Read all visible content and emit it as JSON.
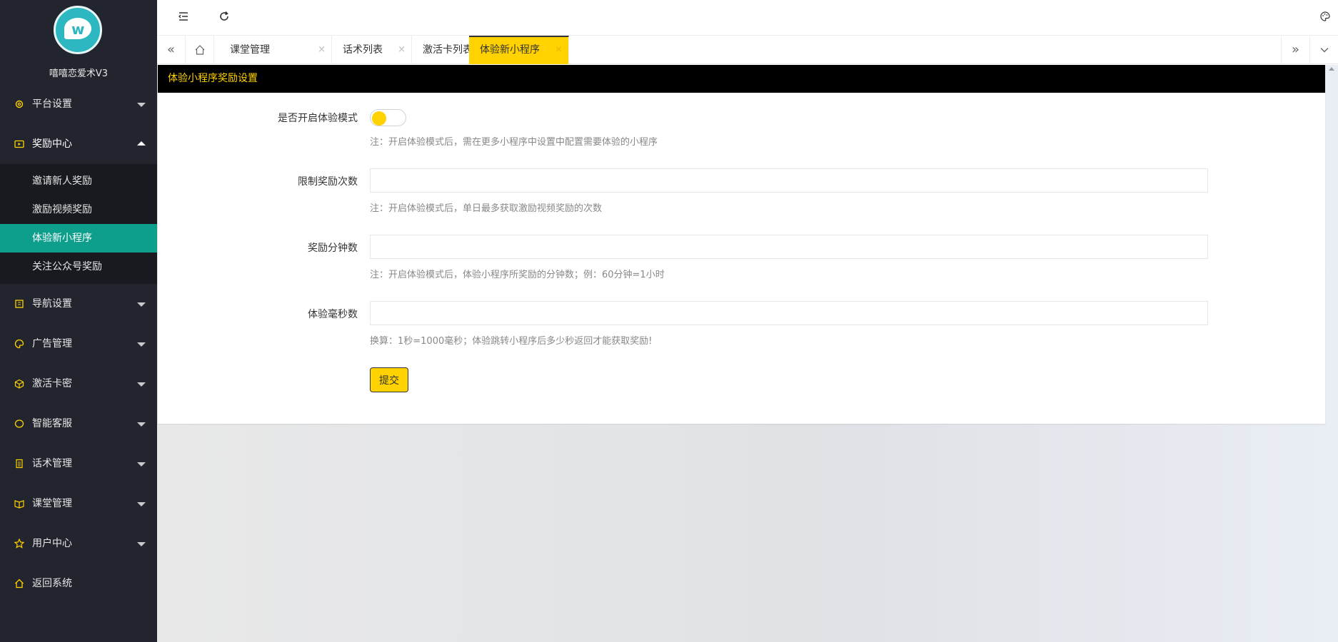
{
  "sidebar": {
    "app_name": "嘻嘻恋爱术V3",
    "menu": [
      {
        "label": "平台设置",
        "icon": "gear-icon"
      },
      {
        "label": "奖励中心",
        "icon": "video-icon"
      },
      {
        "label": "导航设置",
        "icon": "book-icon"
      },
      {
        "label": "广告管理",
        "icon": "palette-icon"
      },
      {
        "label": "激活卡密",
        "icon": "cube-icon"
      },
      {
        "label": "智能客服",
        "icon": "chat-icon"
      },
      {
        "label": "话术管理",
        "icon": "doc-icon"
      },
      {
        "label": "课堂管理",
        "icon": "reading-icon"
      },
      {
        "label": "用户中心",
        "icon": "star-icon"
      },
      {
        "label": "返回系统",
        "icon": "home-icon"
      }
    ],
    "reward_submenu": [
      {
        "label": "邀请新人奖励"
      },
      {
        "label": "激励视频奖励"
      },
      {
        "label": "体验新小程序"
      },
      {
        "label": "关注公众号奖励"
      }
    ]
  },
  "tabs": [
    {
      "label": "课堂管理"
    },
    {
      "label": "话术列表"
    },
    {
      "label": "激活卡列表"
    },
    {
      "label": "体验新小程序"
    }
  ],
  "tab_close_glyph": "×",
  "card": {
    "title": "体验小程序奖励设置",
    "fields": {
      "enable": {
        "label": "是否开启体验模式",
        "tip": "注：开启体验模式后，需在更多小程序中设置中配置需要体验的小程序"
      },
      "limit": {
        "label": "限制奖励次数",
        "value": "",
        "tip": "注：开启体验模式后，单日最多获取激励视频奖励的次数"
      },
      "minutes": {
        "label": "奖励分钟数",
        "value": "",
        "tip": "注：开启体验模式后，体验小程序所奖励的分钟数；例：60分钟=1小时"
      },
      "ms": {
        "label": "体验毫秒数",
        "value": "",
        "tip": "换算：1秒=1000毫秒；体验跳转小程序后多少秒返回才能获取奖励!"
      }
    },
    "submit_label": "提交"
  },
  "colors": {
    "accent": "#ffd200",
    "sidebar_bg": "#22252e",
    "active_sub": "#0e9e8c",
    "header_bg": "#000000"
  }
}
